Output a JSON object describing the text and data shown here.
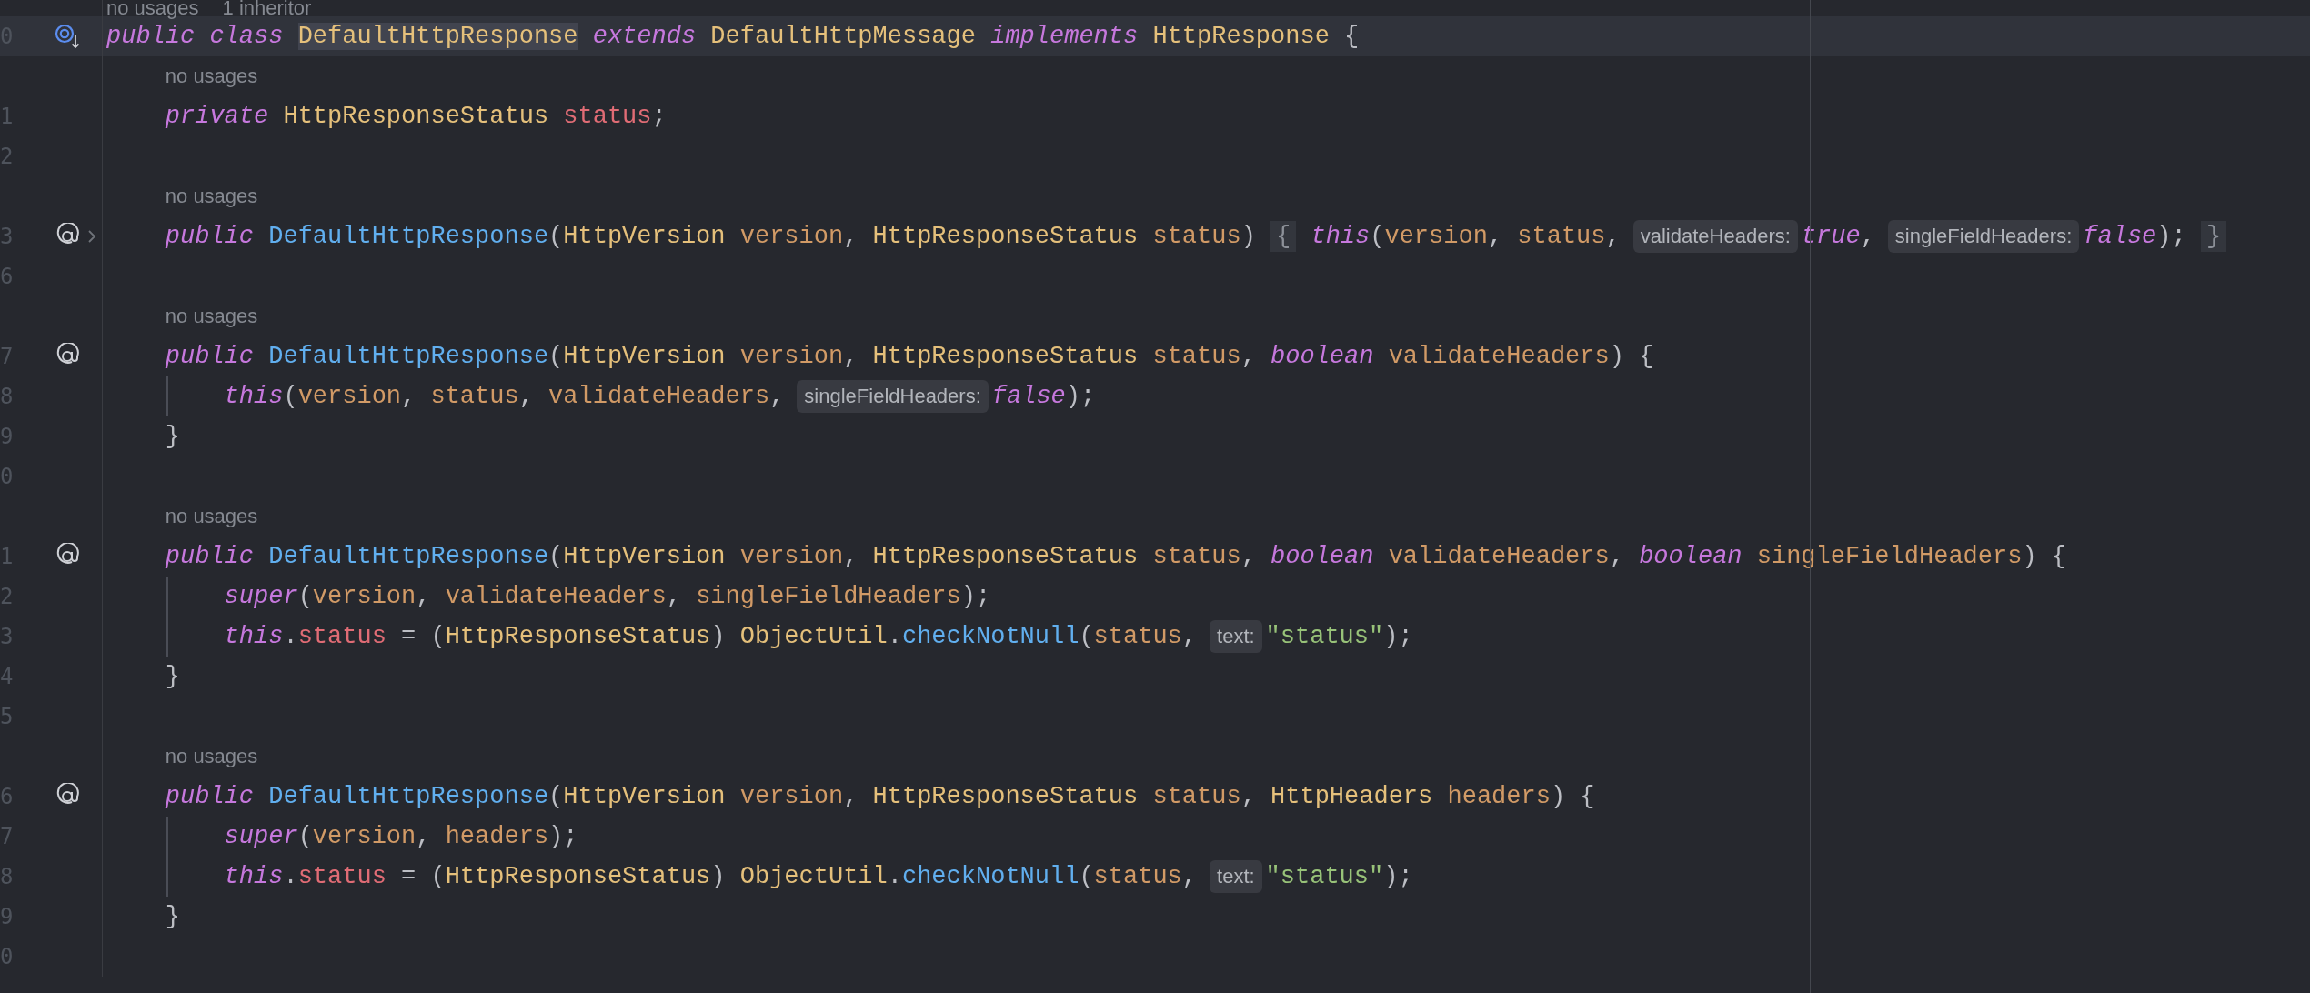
{
  "editor": {
    "lines": [
      {
        "kind": "hint",
        "indented": false,
        "texts": [
          "no usages",
          "1 inheritor"
        ]
      },
      {
        "kind": "code",
        "number": "0",
        "current": true,
        "folded": false,
        "guide": false,
        "gutter_icon": {
          "kind": "implemented"
        },
        "segments": [
          {
            "kind": "code",
            "tokens": [
              {
                "kind": "keyword",
                "text": "public class "
              },
              {
                "kind": "class",
                "text": "DefaultHttpResponse",
                "highlighted": true
              },
              {
                "kind": "keyword",
                "text": " extends"
              },
              {
                "kind": "class",
                "text": " DefaultHttpMessage "
              },
              {
                "kind": "keyword",
                "text": "implements"
              },
              {
                "kind": "class",
                "text": " HttpResponse"
              },
              {
                "kind": "plain",
                "text": " {"
              }
            ]
          }
        ]
      },
      {
        "kind": "hint",
        "indented": true,
        "texts": [
          "no usages"
        ]
      },
      {
        "kind": "code",
        "number": "1",
        "current": false,
        "folded": false,
        "guide": false,
        "segments": [
          {
            "kind": "code",
            "tokens": [
              {
                "kind": "keyword",
                "text": "    private "
              },
              {
                "kind": "class",
                "text": "HttpResponseStatus "
              },
              {
                "kind": "field",
                "text": "status"
              },
              {
                "kind": "plain",
                "text": ";"
              }
            ]
          }
        ]
      },
      {
        "kind": "code",
        "number": "2",
        "current": false,
        "folded": false,
        "guide": false
      },
      {
        "kind": "hint",
        "indented": true,
        "texts": [
          "no usages"
        ]
      },
      {
        "kind": "code",
        "number": "3",
        "current": false,
        "folded": true,
        "guide": false,
        "gutter_icon": {
          "kind": "annotation"
        },
        "segments": [
          {
            "kind": "code",
            "tokens": [
              {
                "kind": "keyword",
                "text": "    public "
              },
              {
                "kind": "method",
                "text": "DefaultHttpResponse"
              },
              {
                "kind": "plain",
                "text": "("
              },
              {
                "kind": "class",
                "text": "HttpVersion "
              },
              {
                "kind": "param",
                "text": "version"
              },
              {
                "kind": "plain",
                "text": ", "
              },
              {
                "kind": "class",
                "text": "HttpResponseStatus "
              },
              {
                "kind": "param",
                "text": "status"
              },
              {
                "kind": "plain",
                "text": ") "
              }
            ]
          },
          {
            "kind": "fold",
            "text": "{"
          },
          {
            "kind": "code",
            "tokens": [
              {
                "kind": "keyword",
                "text": " this"
              },
              {
                "kind": "plain",
                "text": "("
              },
              {
                "kind": "param",
                "text": "version"
              },
              {
                "kind": "plain",
                "text": ", "
              },
              {
                "kind": "param",
                "text": "status"
              },
              {
                "kind": "plain",
                "text": ","
              }
            ]
          },
          {
            "kind": "inlay",
            "text": "validateHeaders:"
          },
          {
            "kind": "code",
            "tokens": [
              {
                "kind": "keyword",
                "text": "true"
              },
              {
                "kind": "plain",
                "text": ","
              }
            ]
          },
          {
            "kind": "inlay",
            "text": "singleFieldHeaders:"
          },
          {
            "kind": "code",
            "tokens": [
              {
                "kind": "keyword",
                "text": "false"
              },
              {
                "kind": "plain",
                "text": "); "
              }
            ]
          },
          {
            "kind": "fold",
            "text": "}"
          }
        ]
      },
      {
        "kind": "code",
        "number": "6",
        "current": false,
        "folded": false,
        "guide": false
      },
      {
        "kind": "hint",
        "indented": true,
        "texts": [
          "no usages"
        ]
      },
      {
        "kind": "code",
        "number": "7",
        "current": false,
        "folded": false,
        "guide": false,
        "gutter_icon": {
          "kind": "annotation"
        },
        "segments": [
          {
            "kind": "code",
            "tokens": [
              {
                "kind": "keyword",
                "text": "    public "
              },
              {
                "kind": "method",
                "text": "DefaultHttpResponse"
              },
              {
                "kind": "plain",
                "text": "("
              },
              {
                "kind": "class",
                "text": "HttpVersion "
              },
              {
                "kind": "param",
                "text": "version"
              },
              {
                "kind": "plain",
                "text": ", "
              },
              {
                "kind": "class",
                "text": "HttpResponseStatus "
              },
              {
                "kind": "param",
                "text": "status"
              },
              {
                "kind": "plain",
                "text": ", "
              },
              {
                "kind": "keyword",
                "text": "boolean "
              },
              {
                "kind": "param",
                "text": "validateHeaders"
              },
              {
                "kind": "plain",
                "text": ") {"
              }
            ]
          }
        ]
      },
      {
        "kind": "code",
        "number": "8",
        "current": false,
        "folded": false,
        "guide": true,
        "segments": [
          {
            "kind": "code",
            "tokens": [
              {
                "kind": "keyword",
                "text": "        this"
              },
              {
                "kind": "plain",
                "text": "("
              },
              {
                "kind": "param",
                "text": "version"
              },
              {
                "kind": "plain",
                "text": ", "
              },
              {
                "kind": "param",
                "text": "status"
              },
              {
                "kind": "plain",
                "text": ", "
              },
              {
                "kind": "param",
                "text": "validateHeaders"
              },
              {
                "kind": "plain",
                "text": ","
              }
            ]
          },
          {
            "kind": "inlay",
            "text": "singleFieldHeaders:"
          },
          {
            "kind": "code",
            "tokens": [
              {
                "kind": "keyword",
                "text": "false"
              },
              {
                "kind": "plain",
                "text": ");"
              }
            ]
          }
        ]
      },
      {
        "kind": "code",
        "number": "9",
        "current": false,
        "folded": false,
        "guide": false,
        "segments": [
          {
            "kind": "code",
            "tokens": [
              {
                "kind": "plain",
                "text": "    }"
              }
            ]
          }
        ]
      },
      {
        "kind": "code",
        "number": "0",
        "current": false,
        "folded": false,
        "guide": false
      },
      {
        "kind": "hint",
        "indented": true,
        "texts": [
          "no usages"
        ]
      },
      {
        "kind": "code",
        "number": "1",
        "current": false,
        "folded": false,
        "guide": false,
        "gutter_icon": {
          "kind": "annotation"
        },
        "segments": [
          {
            "kind": "code",
            "tokens": [
              {
                "kind": "keyword",
                "text": "    public "
              },
              {
                "kind": "method",
                "text": "DefaultHttpResponse"
              },
              {
                "kind": "plain",
                "text": "("
              },
              {
                "kind": "class",
                "text": "HttpVersion "
              },
              {
                "kind": "param",
                "text": "version"
              },
              {
                "kind": "plain",
                "text": ", "
              },
              {
                "kind": "class",
                "text": "HttpResponseStatus "
              },
              {
                "kind": "param",
                "text": "status"
              },
              {
                "kind": "plain",
                "text": ", "
              },
              {
                "kind": "keyword",
                "text": "boolean "
              },
              {
                "kind": "param",
                "text": "validateHeaders"
              },
              {
                "kind": "plain",
                "text": ", "
              },
              {
                "kind": "keyword",
                "text": "boolean "
              },
              {
                "kind": "param",
                "text": "singleFieldHeaders"
              },
              {
                "kind": "plain",
                "text": ") {"
              }
            ]
          }
        ]
      },
      {
        "kind": "code",
        "number": "2",
        "current": false,
        "folded": false,
        "guide": true,
        "segments": [
          {
            "kind": "code",
            "tokens": [
              {
                "kind": "keyword",
                "text": "        super"
              },
              {
                "kind": "plain",
                "text": "("
              },
              {
                "kind": "param",
                "text": "version"
              },
              {
                "kind": "plain",
                "text": ", "
              },
              {
                "kind": "param",
                "text": "validateHeaders"
              },
              {
                "kind": "plain",
                "text": ", "
              },
              {
                "kind": "param",
                "text": "singleFieldHeaders"
              },
              {
                "kind": "plain",
                "text": ");"
              }
            ]
          }
        ]
      },
      {
        "kind": "code",
        "number": "3",
        "current": false,
        "folded": false,
        "guide": true,
        "segments": [
          {
            "kind": "code",
            "tokens": [
              {
                "kind": "keyword",
                "text": "        this"
              },
              {
                "kind": "plain",
                "text": "."
              },
              {
                "kind": "field",
                "text": "status"
              },
              {
                "kind": "plain",
                "text": " = ("
              },
              {
                "kind": "class",
                "text": "HttpResponseStatus"
              },
              {
                "kind": "plain",
                "text": ") "
              },
              {
                "kind": "class",
                "text": "ObjectUtil"
              },
              {
                "kind": "plain",
                "text": "."
              },
              {
                "kind": "method",
                "text": "checkNotNull"
              },
              {
                "kind": "plain",
                "text": "("
              },
              {
                "kind": "param",
                "text": "status"
              },
              {
                "kind": "plain",
                "text": ","
              }
            ]
          },
          {
            "kind": "inlay",
            "text": "text:"
          },
          {
            "kind": "code",
            "tokens": [
              {
                "kind": "string",
                "text": "\"status\""
              },
              {
                "kind": "plain",
                "text": ");"
              }
            ]
          }
        ]
      },
      {
        "kind": "code",
        "number": "4",
        "current": false,
        "folded": false,
        "guide": false,
        "segments": [
          {
            "kind": "code",
            "tokens": [
              {
                "kind": "plain",
                "text": "    }"
              }
            ]
          }
        ]
      },
      {
        "kind": "code",
        "number": "5",
        "current": false,
        "folded": false,
        "guide": false
      },
      {
        "kind": "hint",
        "indented": true,
        "texts": [
          "no usages"
        ]
      },
      {
        "kind": "code",
        "number": "6",
        "current": false,
        "folded": false,
        "guide": false,
        "gutter_icon": {
          "kind": "annotation"
        },
        "segments": [
          {
            "kind": "code",
            "tokens": [
              {
                "kind": "keyword",
                "text": "    public "
              },
              {
                "kind": "method",
                "text": "DefaultHttpResponse"
              },
              {
                "kind": "plain",
                "text": "("
              },
              {
                "kind": "class",
                "text": "HttpVersion "
              },
              {
                "kind": "param",
                "text": "version"
              },
              {
                "kind": "plain",
                "text": ", "
              },
              {
                "kind": "class",
                "text": "HttpResponseStatus "
              },
              {
                "kind": "param",
                "text": "status"
              },
              {
                "kind": "plain",
                "text": ", "
              },
              {
                "kind": "class",
                "text": "HttpHeaders "
              },
              {
                "kind": "param",
                "text": "headers"
              },
              {
                "kind": "plain",
                "text": ") {"
              }
            ]
          }
        ]
      },
      {
        "kind": "code",
        "number": "7",
        "current": false,
        "folded": false,
        "guide": true,
        "segments": [
          {
            "kind": "code",
            "tokens": [
              {
                "kind": "keyword",
                "text": "        super"
              },
              {
                "kind": "plain",
                "text": "("
              },
              {
                "kind": "param",
                "text": "version"
              },
              {
                "kind": "plain",
                "text": ", "
              },
              {
                "kind": "param",
                "text": "headers"
              },
              {
                "kind": "plain",
                "text": ");"
              }
            ]
          }
        ]
      },
      {
        "kind": "code",
        "number": "8",
        "current": false,
        "folded": false,
        "guide": true,
        "segments": [
          {
            "kind": "code",
            "tokens": [
              {
                "kind": "keyword",
                "text": "        this"
              },
              {
                "kind": "plain",
                "text": "."
              },
              {
                "kind": "field",
                "text": "status"
              },
              {
                "kind": "plain",
                "text": " = ("
              },
              {
                "kind": "class",
                "text": "HttpResponseStatus"
              },
              {
                "kind": "plain",
                "text": ") "
              },
              {
                "kind": "class",
                "text": "ObjectUtil"
              },
              {
                "kind": "plain",
                "text": "."
              },
              {
                "kind": "method",
                "text": "checkNotNull"
              },
              {
                "kind": "plain",
                "text": "("
              },
              {
                "kind": "param",
                "text": "status"
              },
              {
                "kind": "plain",
                "text": ","
              }
            ]
          },
          {
            "kind": "inlay",
            "text": "text:"
          },
          {
            "kind": "code",
            "tokens": [
              {
                "kind": "string",
                "text": "\"status\""
              },
              {
                "kind": "plain",
                "text": ");"
              }
            ]
          }
        ]
      },
      {
        "kind": "code",
        "number": "9",
        "current": false,
        "folded": false,
        "guide": false,
        "segments": [
          {
            "kind": "code",
            "tokens": [
              {
                "kind": "plain",
                "text": "    }"
              }
            ]
          }
        ]
      },
      {
        "kind": "code",
        "number": "0",
        "current": false,
        "folded": false,
        "guide": false
      }
    ]
  }
}
